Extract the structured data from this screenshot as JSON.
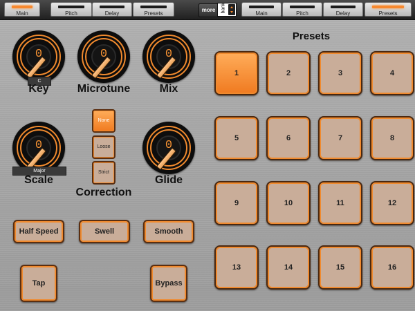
{
  "tabs_left": [
    {
      "label": "Main",
      "active": true
    },
    {
      "label": "Pitch",
      "active": false
    },
    {
      "label": "Delay",
      "active": false
    },
    {
      "label": "Presets",
      "active": false
    }
  ],
  "tabs_right": [
    {
      "label": "Main",
      "active": false
    },
    {
      "label": "Pitch",
      "active": false
    },
    {
      "label": "Delay",
      "active": false
    },
    {
      "label": "Presets",
      "active": true
    }
  ],
  "more_label": "more",
  "bank_label": "bank",
  "knobs": {
    "key": {
      "label": "Key",
      "value": "0",
      "sub": "C"
    },
    "microtune": {
      "label": "Microtune",
      "value": "0"
    },
    "mix": {
      "label": "Mix",
      "value": "0"
    },
    "scale": {
      "label": "Scale",
      "value": "0",
      "sub": "Major"
    },
    "glide": {
      "label": "Glide",
      "value": "0"
    }
  },
  "correction": {
    "label": "Correction",
    "options": [
      {
        "label": "None",
        "selected": true
      },
      {
        "label": "Loose",
        "selected": false
      },
      {
        "label": "Strict",
        "selected": false
      }
    ]
  },
  "buttons": {
    "half_speed": "Half Speed",
    "swell": "Swell",
    "smooth": "Smooth",
    "tap": "Tap",
    "bypass": "Bypass"
  },
  "presets": {
    "title": "Presets",
    "selected": "1",
    "pads": [
      "1",
      "2",
      "3",
      "4",
      "5",
      "6",
      "7",
      "8",
      "9",
      "10",
      "11",
      "12",
      "13",
      "14",
      "15",
      "16"
    ]
  },
  "colors": {
    "accent": "#f08a2e",
    "pad": "#c9ad99"
  }
}
